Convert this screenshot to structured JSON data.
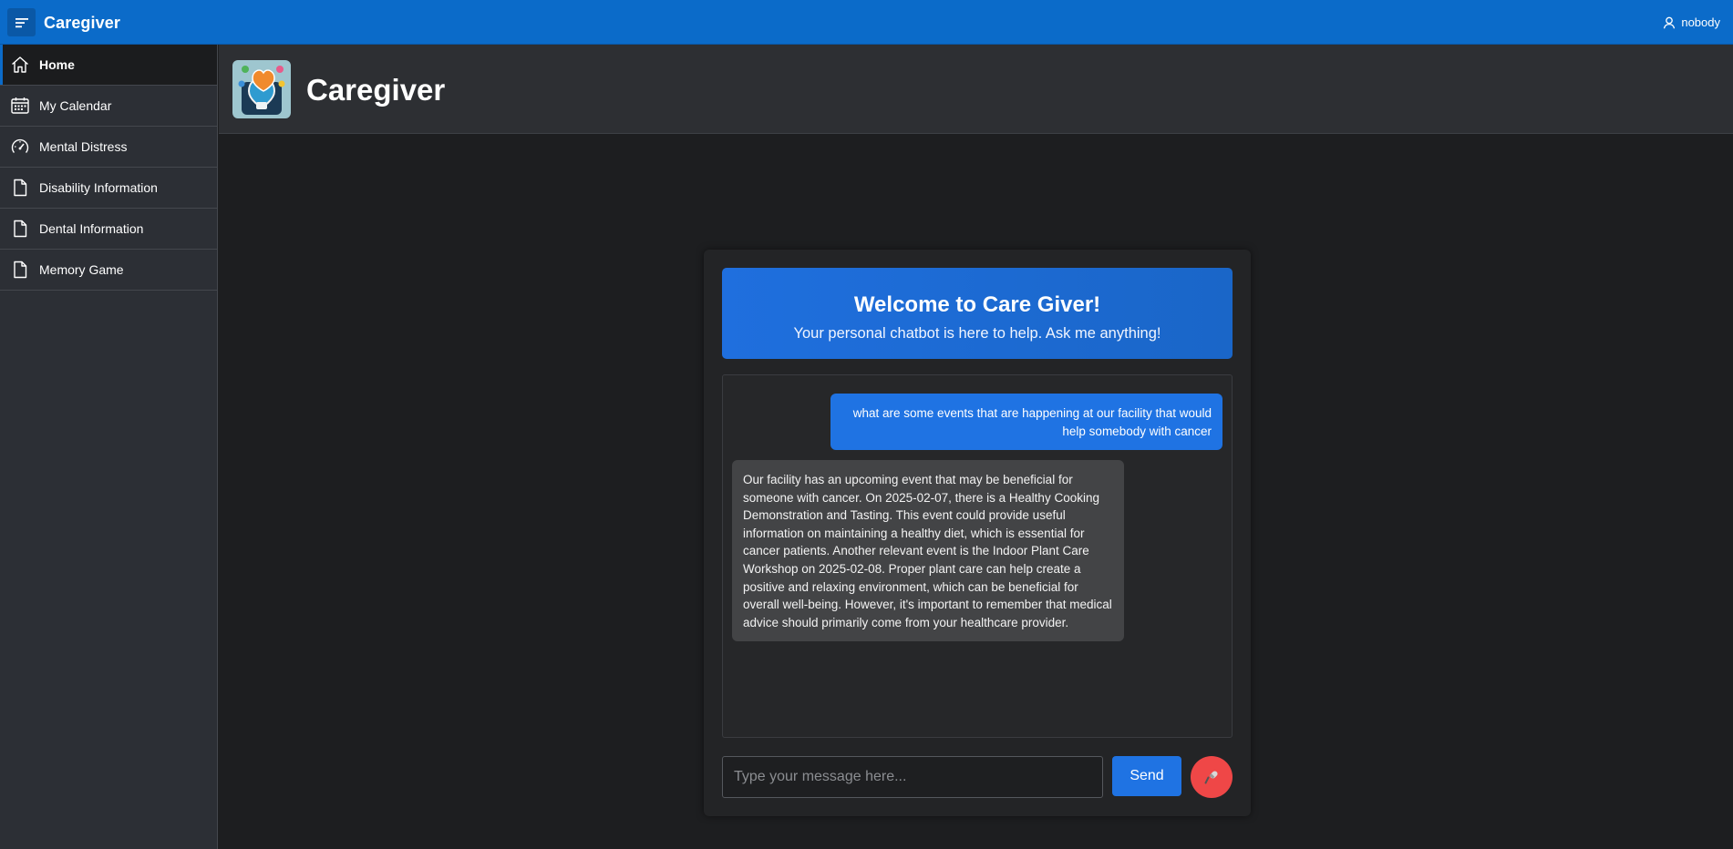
{
  "topbar": {
    "app_title": "Caregiver",
    "username": "nobody"
  },
  "sidebar": {
    "items": [
      {
        "label": "Home",
        "icon": "home-icon"
      },
      {
        "label": "My Calendar",
        "icon": "calendar-icon"
      },
      {
        "label": "Mental Distress",
        "icon": "gauge-icon"
      },
      {
        "label": "Disability Information",
        "icon": "document-icon"
      },
      {
        "label": "Dental Information",
        "icon": "document-icon"
      },
      {
        "label": "Memory Game",
        "icon": "document-icon"
      }
    ]
  },
  "header": {
    "title": "Caregiver"
  },
  "chat": {
    "welcome_title": "Welcome to Care Giver!",
    "welcome_subtitle": "Your personal chatbot is here to help. Ask me anything!",
    "messages": [
      {
        "role": "user",
        "text": "what are some events that are happening at our facility that would help somebody with cancer"
      },
      {
        "role": "bot",
        "text": "Our facility has an upcoming event that may be beneficial for someone with cancer. On 2025-02-07, there is a Healthy Cooking Demonstration and Tasting. This event could provide useful information on maintaining a healthy diet, which is essential for cancer patients. Another relevant event is the Indoor Plant Care Workshop on 2025-02-08. Proper plant care can help create a positive and relaxing environment, which can be beneficial for overall well-being. However, it's important to remember that medical advice should primarily come from your healthcare provider."
      }
    ],
    "input_value": "",
    "input_placeholder": "Type your message here...",
    "send_label": "Send"
  },
  "colors": {
    "topbar": "#0b6bc9",
    "accent": "#1f73e3",
    "mic": "#ef4747",
    "sidebar": "#2c2f35",
    "background": "#1d1e20"
  }
}
